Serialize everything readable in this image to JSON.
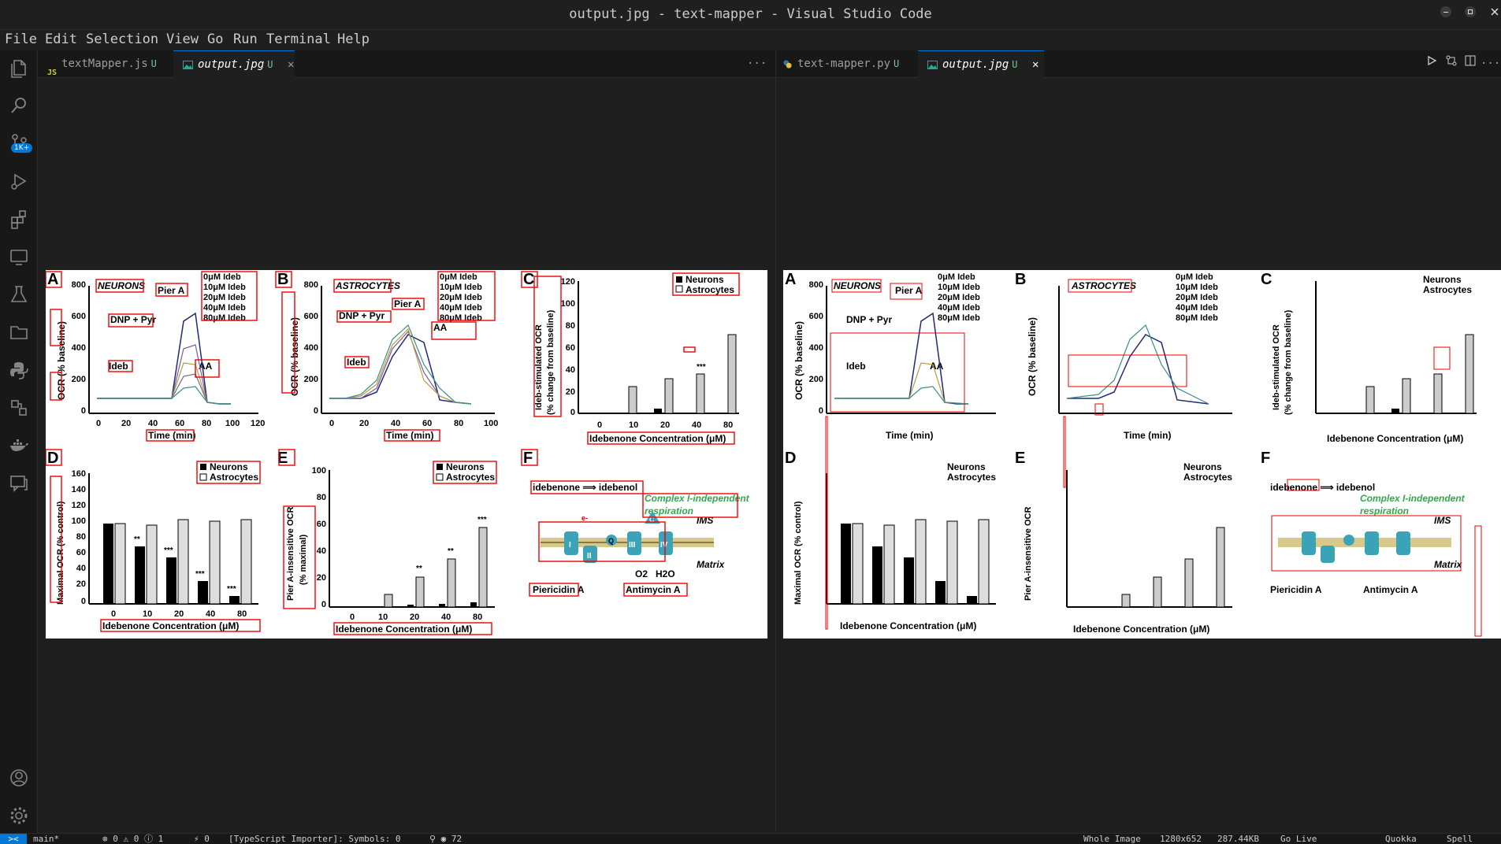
{
  "window": {
    "title": "output.jpg - text-mapper - Visual Studio Code"
  },
  "menu": [
    "File",
    "Edit",
    "Selection",
    "View",
    "Go",
    "Run",
    "Terminal",
    "Help"
  ],
  "activity": {
    "scm_badge": "1K+"
  },
  "left_group": {
    "tabs": [
      {
        "label": "textMapper.js",
        "mod": "U",
        "icon": "js-icon"
      },
      {
        "label": "output.jpg",
        "mod": "U",
        "icon": "image-icon"
      }
    ],
    "more": "···"
  },
  "right_group": {
    "tabs": [
      {
        "label": "text-mapper.py",
        "mod": "U",
        "icon": "python-icon"
      },
      {
        "label": "output.jpg",
        "mod": "U",
        "icon": "image-icon"
      }
    ],
    "more": "···"
  },
  "figure": {
    "panel_letters": [
      "A",
      "B",
      "C",
      "D",
      "E",
      "F"
    ],
    "A": {
      "region": "NEURONS",
      "legend": [
        "0μM Ideb",
        "10μM Ideb",
        "20μM Ideb",
        "40μM Ideb",
        "80μM Ideb"
      ],
      "ylabel": "OCR (% baseline)",
      "xlabel": "Time (min)",
      "yticks": [
        "800",
        "600",
        "400",
        "200",
        "0"
      ],
      "xticks": [
        "0",
        "20",
        "40",
        "60",
        "80",
        "100",
        "120"
      ],
      "annot": [
        "Pier A",
        "DNP + Pyr",
        "Ideb",
        "AA"
      ]
    },
    "B": {
      "region": "ASTROCYTES",
      "legend": [
        "0μM Ideb",
        "10μM Ideb",
        "20μM Ideb",
        "40μM Ideb",
        "80μM Ideb"
      ],
      "ylabel": "OCR (% baseline)",
      "xlabel": "Time (min)",
      "yticks": [
        "800",
        "600",
        "400",
        "200",
        "0"
      ],
      "xticks": [
        "0",
        "20",
        "40",
        "60",
        "80",
        "100"
      ],
      "annot": [
        "Pier A",
        "DNP + Pyr",
        "Ideb",
        "AA"
      ]
    },
    "C": {
      "legend": [
        "Neurons",
        "Astrocytes"
      ],
      "ylabel": "Ideb-stimulated OCR",
      "ylabel2": "(% change from baseline)",
      "xlabel": "Idebenone Concentration (μM)",
      "yticks": [
        "120",
        "100",
        "80",
        "60",
        "40",
        "20",
        "0"
      ],
      "xticks": [
        "0",
        "10",
        "20",
        "40",
        "80"
      ],
      "stars": "***"
    },
    "D": {
      "legend": [
        "Neurons",
        "Astrocytes"
      ],
      "ylabel": "Maximal OCR (% control)",
      "xlabel": "Idebenone Concentration (μM)",
      "yticks": [
        "160",
        "140",
        "120",
        "100",
        "80",
        "60",
        "40",
        "20",
        "0"
      ],
      "xticks": [
        "0",
        "10",
        "20",
        "40",
        "80"
      ],
      "stars": [
        "**",
        "***",
        "***",
        "***"
      ]
    },
    "E": {
      "legend": [
        "Neurons",
        "Astrocytes"
      ],
      "ylabel": "Pier A-insensitive OCR",
      "ylabel2": "(% maximal)",
      "xlabel": "Idebenone Concentration (μM)",
      "yticks": [
        "100",
        "80",
        "60",
        "40",
        "20",
        "0"
      ],
      "xticks": [
        "0",
        "10",
        "20",
        "40",
        "80"
      ],
      "stars": [
        "**",
        "**",
        "***"
      ]
    },
    "F": {
      "equation": "idebenone ⟹ idebenol",
      "complex": "Complex I-independent",
      "respiration": "respiration",
      "ims": "IMS",
      "matrix": "Matrix",
      "piericidin": "Piericidin A",
      "antimycin": "Antimycin A",
      "o2": "O2",
      "h2o": "H2O",
      "complexes": [
        "I",
        "II",
        "Q",
        "III",
        "C",
        "IV"
      ],
      "electron": "e-"
    }
  },
  "status": {
    "remote": "><",
    "branch": "main*",
    "problems": "⊗ 0  ⚠ 0  ⓘ 1",
    "ports": "⚡ 0",
    "importer": "[TypeScript Importer]: Symbols: 0",
    "misc": "⚲  ◉ 72",
    "whole": "Whole Image",
    "dims": "1280x652",
    "size": "287.44KB",
    "golive": "Go Live",
    "quokka": "Quokka",
    "spell": "Spell"
  }
}
